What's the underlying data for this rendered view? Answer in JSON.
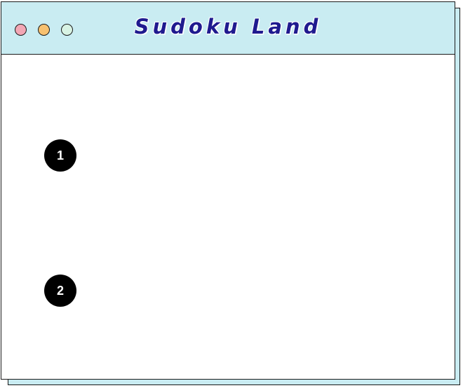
{
  "window": {
    "title": "Sudoku Land",
    "controls": {
      "close_color": "#f2a7b5",
      "minimize_color": "#f7c170",
      "maximize_color": "#d8f3e4"
    }
  },
  "content": {
    "markers": [
      {
        "label": "1"
      },
      {
        "label": "2"
      }
    ]
  },
  "colors": {
    "titlebar_bg": "#c9ecf2",
    "title_text": "#1f1a8f",
    "marker_bg": "#000000",
    "marker_text": "#ffffff"
  }
}
